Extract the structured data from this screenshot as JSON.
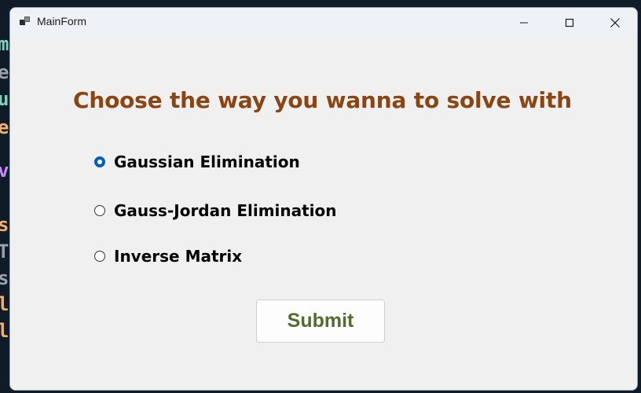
{
  "window": {
    "title": "MainForm"
  },
  "form": {
    "heading": "Choose the way you wanna to solve with",
    "options": [
      {
        "label": "Gaussian Elimination",
        "checked": true
      },
      {
        "label": "Gauss-Jordan Elimination",
        "checked": false
      },
      {
        "label": "Inverse Matrix",
        "checked": false
      }
    ],
    "submit_label": "Submit"
  },
  "colors": {
    "heading": "#8b4513",
    "submit_text": "#556b2f",
    "radio_accent": "#005fb8"
  },
  "icons": {
    "app": "app-window-icon",
    "minimize": "minimize-icon",
    "maximize": "maximize-icon",
    "close": "close-icon"
  }
}
